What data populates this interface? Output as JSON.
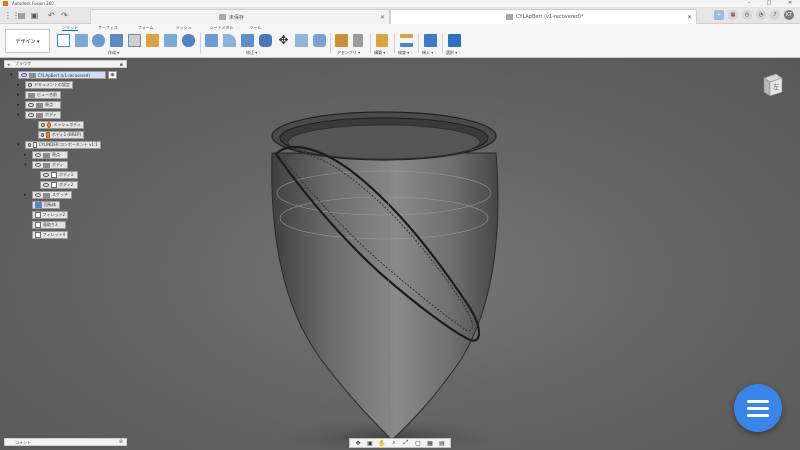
{
  "app": {
    "title": "Autodesk Fusion 360",
    "brand_color": "#f37021",
    "accent_color": "#0a6fc2"
  },
  "tabs": [
    {
      "label": "未保存",
      "active": false
    },
    {
      "label": "CYLApBert (v1-recovered)*",
      "active": true
    }
  ],
  "user": {
    "initials": "KT"
  },
  "ribbon": {
    "workspace": "デザイン ▾",
    "tabs": [
      "ソリッド",
      "サーフェス",
      "フォーム",
      "メッシュ",
      "シートメタル",
      "ツール"
    ],
    "groups": [
      "作成 ▾",
      "修正 ▾",
      "アセンブリ ▾",
      "構築 ▾",
      "検査 ▾",
      "挿入 ▾",
      "選択 ▾"
    ]
  },
  "browser": {
    "title": "ブラウザ",
    "nodes": [
      {
        "label": "CYLApBert (v1-recovered)",
        "icon": "document-icon"
      },
      {
        "label": "ドキュメントの設定",
        "icon": "gear-icon"
      },
      {
        "label": "ビュー名前",
        "icon": "folder-icon"
      },
      {
        "label": "原点",
        "icon": "folder-icon"
      },
      {
        "label": "ボディ",
        "icon": "folder-icon"
      },
      {
        "label": "メッシュボディ",
        "icon": "mesh-body-icon"
      },
      {
        "label": "ボディ1 (BREP)",
        "icon": "brep-body-icon"
      },
      {
        "label": "CYLINDER:コンポーネント v1:1",
        "icon": "component-icon"
      },
      {
        "label": "原点",
        "icon": "folder-icon"
      },
      {
        "label": "ボディ",
        "icon": "folder-icon"
      },
      {
        "label": "ボディ1",
        "icon": "body-icon"
      },
      {
        "label": "ボディ2",
        "icon": "body-icon"
      },
      {
        "label": "スケッチ",
        "icon": "folder-icon"
      },
      {
        "label": "回転体",
        "icon": "revolve-icon"
      },
      {
        "label": "フィレット2",
        "icon": "fillet-icon"
      },
      {
        "label": "面取り3",
        "icon": "chamfer-icon"
      },
      {
        "label": "フィレット4",
        "icon": "fillet-icon"
      }
    ]
  },
  "viewcube": {
    "face_label": "左"
  },
  "comments": {
    "title": "コメント"
  },
  "navbar": {
    "tools": [
      "orbit-icon",
      "look-at-icon",
      "pan-icon",
      "zoom-icon",
      "fit-icon",
      "display-settings-icon",
      "grid-icon",
      "viewports-icon"
    ]
  }
}
